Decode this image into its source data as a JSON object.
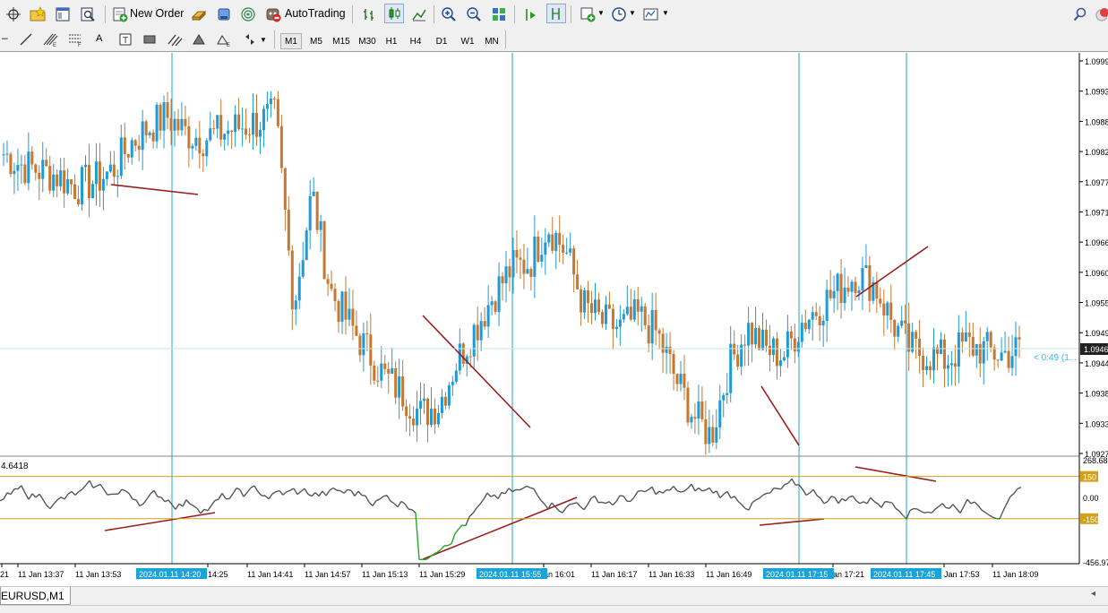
{
  "toolbar": {
    "new_order_label": "New Order",
    "autotrading_label": "AutoTrading",
    "timeframes": [
      "M1",
      "M5",
      "M15",
      "M30",
      "H1",
      "H4",
      "D1",
      "W1",
      "MN"
    ],
    "selected_timeframe": "M1"
  },
  "chart_tab": {
    "label": "EURUSD,M1"
  },
  "price_axis": {
    "labels": [
      "1.0999",
      "1.0993",
      "1.0988",
      "1.0982",
      "1.0977",
      "1.0971",
      "1.0966",
      "1.0960",
      "1.0955",
      "1.0949",
      "1.0944",
      "1.0938",
      "1.0933",
      "1.0927"
    ],
    "current_price": "1.0946",
    "countdown": "< 0:49 (1..."
  },
  "indicator": {
    "value_label": "4.6418",
    "axis_labels": [
      "268.68",
      "150",
      "0.00",
      "-150",
      "-456.97"
    ],
    "levels": [
      150,
      -150
    ]
  },
  "time_axis": {
    "labels": [
      "21",
      "11 Jan 13:37",
      "11 Jan 13:53",
      "14:25",
      "11 Jan 14:41",
      "11 Jan 14:57",
      "11 Jan 15:13",
      "11 Jan 15:29",
      "an 16:01",
      "11 Jan 16:17",
      "11 Jan 16:33",
      "11 Jan 16:49",
      "an 17:21",
      "Jan 17:53",
      "11 Jan 18:09"
    ],
    "highlighted": [
      "2024.01.11 14:20",
      "2024.01.11 15:55",
      "2024.01.11 17:15",
      "2024.01.11 17:45"
    ]
  },
  "colors": {
    "bull": "#1e9bd7",
    "bear": "#c8772e",
    "divergence": "#9b1c1c",
    "vline": "#1ba7c9",
    "level": "#d4a017",
    "osc_gray": "#555555",
    "osc_red": "#e01010",
    "osc_green": "#22aa22"
  },
  "chart_data": {
    "type": "candlestick",
    "symbol": "EURUSD",
    "timeframe": "M1",
    "ylim": [
      1.0927,
      1.0999
    ],
    "close_path": [
      1.0982,
      1.098,
      1.0979,
      1.0978,
      1.0976,
      1.0977,
      1.0979,
      1.0984,
      1.0987,
      1.0989,
      1.0986,
      1.0985,
      1.0986,
      1.0987,
      1.0988,
      1.0989,
      1.0954,
      1.0975,
      1.0957,
      1.0951,
      1.0946,
      1.0941,
      1.0938,
      1.0934,
      1.0936,
      1.0944,
      1.095,
      1.0956,
      1.0961,
      1.0962,
      1.0969,
      1.0964,
      1.0954,
      1.0951,
      1.095,
      1.0952,
      1.0949,
      1.0941,
      1.0934,
      1.093,
      1.0943,
      1.095,
      1.0946,
      1.0945,
      1.0951,
      1.0954,
      1.0957,
      1.096,
      1.0958,
      1.0951,
      1.0946,
      1.0945,
      1.0944,
      1.0947,
      1.0946,
      1.0945,
      1.0946
    ]
  }
}
